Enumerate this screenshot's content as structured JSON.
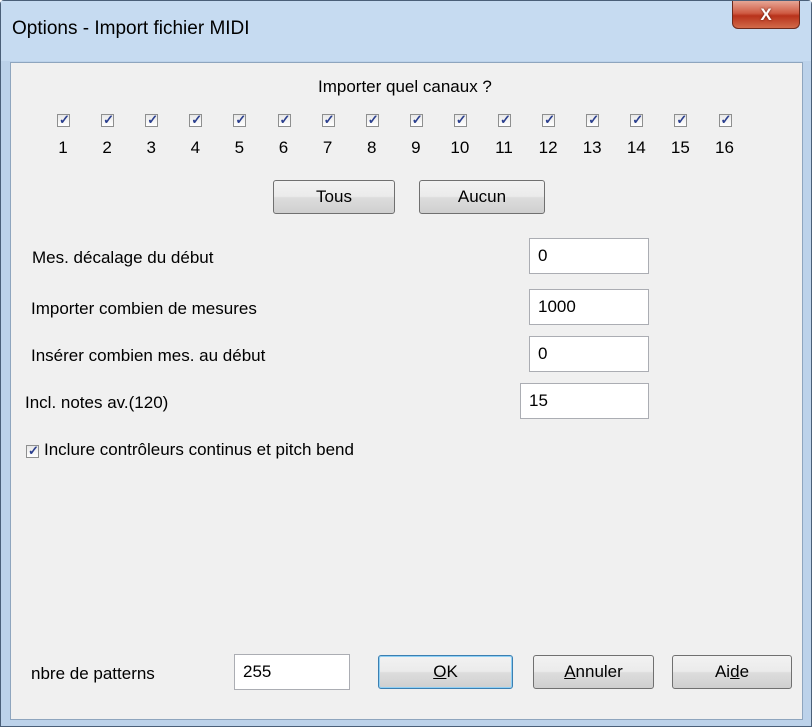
{
  "window": {
    "title": "Options - Import fichier MIDI",
    "close_symbol": "X"
  },
  "channels": {
    "heading": "Importer quel canaux ?",
    "items": [
      {
        "label": "1",
        "checked": true
      },
      {
        "label": "2",
        "checked": true
      },
      {
        "label": "3",
        "checked": true
      },
      {
        "label": "4",
        "checked": true
      },
      {
        "label": "5",
        "checked": true
      },
      {
        "label": "6",
        "checked": true
      },
      {
        "label": "7",
        "checked": true
      },
      {
        "label": "8",
        "checked": true
      },
      {
        "label": "9",
        "checked": true
      },
      {
        "label": "10",
        "checked": true
      },
      {
        "label": "11",
        "checked": true
      },
      {
        "label": "12",
        "checked": true
      },
      {
        "label": "13",
        "checked": true
      },
      {
        "label": "14",
        "checked": true
      },
      {
        "label": "15",
        "checked": true
      },
      {
        "label": "16",
        "checked": true
      }
    ],
    "all_button": "Tous",
    "none_button": "Aucun"
  },
  "fields": {
    "offset": {
      "label": "Mes. décalage du début",
      "value": "0"
    },
    "measures": {
      "label": "Importer combien de mesures",
      "value": "1000"
    },
    "insert": {
      "label": "Insérer combien mes. au début",
      "value": "0"
    },
    "notes_before": {
      "label": "Incl. notes av.(120)",
      "value": "15"
    }
  },
  "controllers": {
    "label": "Inclure contrôleurs continus et pitch bend",
    "checked": true
  },
  "footer": {
    "patterns_label": "nbre de patterns",
    "patterns_value": "255",
    "ok": {
      "pre": "",
      "mnemonic": "O",
      "post": "K"
    },
    "cancel": {
      "pre": "",
      "mnemonic": "A",
      "post": "nnuler"
    },
    "help": {
      "pre": "Ai",
      "mnemonic": "d",
      "post": "e"
    }
  },
  "check_symbol": "✓"
}
